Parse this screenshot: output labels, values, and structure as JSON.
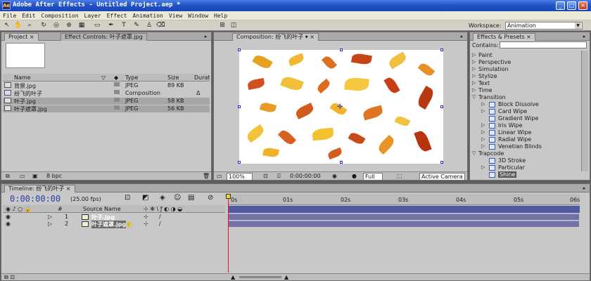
{
  "window": {
    "title": "Adobe After Effects - Untitled Project.aep *",
    "icon_text": "Ae"
  },
  "menu": [
    "File",
    "Edit",
    "Composition",
    "Layer",
    "Effect",
    "Animation",
    "View",
    "Window",
    "Help"
  ],
  "toolbar": {
    "workspace_label": "Workspace:",
    "workspace_value": "Animation"
  },
  "project_panel": {
    "tabs": {
      "project": "Project",
      "effect_controls": "Effect Controls: 叶子遮罩.jpg"
    },
    "columns": [
      "Name",
      "Type",
      "Size",
      "Durat"
    ],
    "items": [
      {
        "name": "背景.jpg",
        "type": "JPEG",
        "size": "89 KB",
        "duration": "",
        "selected": false
      },
      {
        "name": "纷飞的叶子",
        "type": "Composition",
        "size": "",
        "duration": "Δ",
        "selected": false
      },
      {
        "name": "叶子.jpg",
        "type": "JPEG",
        "size": "58 KB",
        "duration": "",
        "selected": true
      },
      {
        "name": "叶子遮罩.jpg",
        "type": "JPEG",
        "size": "56 KB",
        "duration": "",
        "selected": true
      }
    ],
    "footer_bpc": "8 bpc"
  },
  "comp_panel": {
    "tab": "Composition: 纷飞的叶子",
    "zoom": "100%",
    "timecode": "0:00:00:00",
    "resolution": "Full",
    "camera": "Active Camera"
  },
  "effects_panel": {
    "tab": "Effects & Presets",
    "contains_label": "Contains:",
    "contains_value": "",
    "categories_top": [
      "Paint",
      "Perspective",
      "Simulation",
      "Stylize",
      "Text",
      "Time"
    ],
    "transition": {
      "label": "Transition",
      "items": [
        "Block Dissolve",
        "Card Wipe",
        "Gradient Wipe",
        "Iris Wipe",
        "Linear Wipe",
        "Radial Wipe",
        "Venetian Blinds"
      ]
    },
    "trapcode": {
      "label": "Trapcode",
      "items": [
        "3D Stroke",
        "Particular",
        "Shine"
      ],
      "selected": "Shine"
    }
  },
  "timeline": {
    "tab": "Timeline: 纷飞的叶子",
    "timecode": "0:00:00:00",
    "fps": "(25.00 fps)",
    "source_header": "Source Name",
    "ruler": [
      "0s",
      "01s",
      "02s",
      "03s",
      "04s",
      "05s",
      "06s"
    ],
    "layers": [
      {
        "num": "1",
        "name": "叶子.jpg"
      },
      {
        "num": "2",
        "name": "叶子遮罩.jpg"
      }
    ]
  }
}
